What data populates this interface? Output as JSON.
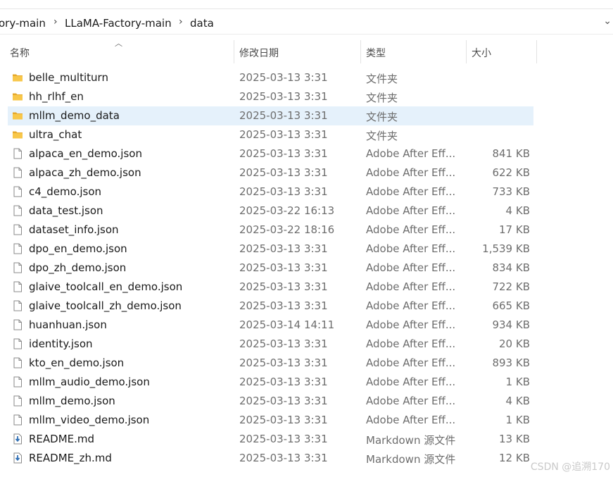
{
  "breadcrumb": {
    "segments": [
      "ory-main",
      "LLaMA-Factory-main",
      "data"
    ],
    "separator": "›"
  },
  "columns": {
    "name": "名称",
    "modified": "修改日期",
    "type": "类型",
    "size": "大小"
  },
  "files": [
    {
      "name": "belle_multiturn",
      "modified": "2025-03-13 3:31",
      "type": "文件夹",
      "size": "",
      "icon": "folder-icon",
      "selected": false
    },
    {
      "name": "hh_rlhf_en",
      "modified": "2025-03-13 3:31",
      "type": "文件夹",
      "size": "",
      "icon": "folder-icon",
      "selected": false
    },
    {
      "name": "mllm_demo_data",
      "modified": "2025-03-13 3:31",
      "type": "文件夹",
      "size": "",
      "icon": "folder-icon",
      "selected": true
    },
    {
      "name": "ultra_chat",
      "modified": "2025-03-13 3:31",
      "type": "文件夹",
      "size": "",
      "icon": "folder-icon",
      "selected": false
    },
    {
      "name": "alpaca_en_demo.json",
      "modified": "2025-03-13 3:31",
      "type": "Adobe After Eff...",
      "size": "841 KB",
      "icon": "file-icon",
      "selected": false
    },
    {
      "name": "alpaca_zh_demo.json",
      "modified": "2025-03-13 3:31",
      "type": "Adobe After Eff...",
      "size": "622 KB",
      "icon": "file-icon",
      "selected": false
    },
    {
      "name": "c4_demo.json",
      "modified": "2025-03-13 3:31",
      "type": "Adobe After Eff...",
      "size": "733 KB",
      "icon": "file-icon",
      "selected": false
    },
    {
      "name": "data_test.json",
      "modified": "2025-03-22 16:13",
      "type": "Adobe After Eff...",
      "size": "4 KB",
      "icon": "file-icon",
      "selected": false
    },
    {
      "name": "dataset_info.json",
      "modified": "2025-03-22 18:16",
      "type": "Adobe After Eff...",
      "size": "17 KB",
      "icon": "file-icon",
      "selected": false
    },
    {
      "name": "dpo_en_demo.json",
      "modified": "2025-03-13 3:31",
      "type": "Adobe After Eff...",
      "size": "1,539 KB",
      "icon": "file-icon",
      "selected": false
    },
    {
      "name": "dpo_zh_demo.json",
      "modified": "2025-03-13 3:31",
      "type": "Adobe After Eff...",
      "size": "834 KB",
      "icon": "file-icon",
      "selected": false
    },
    {
      "name": "glaive_toolcall_en_demo.json",
      "modified": "2025-03-13 3:31",
      "type": "Adobe After Eff...",
      "size": "722 KB",
      "icon": "file-icon",
      "selected": false
    },
    {
      "name": "glaive_toolcall_zh_demo.json",
      "modified": "2025-03-13 3:31",
      "type": "Adobe After Eff...",
      "size": "665 KB",
      "icon": "file-icon",
      "selected": false
    },
    {
      "name": "huanhuan.json",
      "modified": "2025-03-14 14:11",
      "type": "Adobe After Eff...",
      "size": "934 KB",
      "icon": "file-icon",
      "selected": false
    },
    {
      "name": "identity.json",
      "modified": "2025-03-13 3:31",
      "type": "Adobe After Eff...",
      "size": "20 KB",
      "icon": "file-icon",
      "selected": false
    },
    {
      "name": "kto_en_demo.json",
      "modified": "2025-03-13 3:31",
      "type": "Adobe After Eff...",
      "size": "893 KB",
      "icon": "file-icon",
      "selected": false
    },
    {
      "name": "mllm_audio_demo.json",
      "modified": "2025-03-13 3:31",
      "type": "Adobe After Eff...",
      "size": "1 KB",
      "icon": "file-icon",
      "selected": false
    },
    {
      "name": "mllm_demo.json",
      "modified": "2025-03-13 3:31",
      "type": "Adobe After Eff...",
      "size": "4 KB",
      "icon": "file-icon",
      "selected": false
    },
    {
      "name": "mllm_video_demo.json",
      "modified": "2025-03-13 3:31",
      "type": "Adobe After Eff...",
      "size": "1 KB",
      "icon": "file-icon",
      "selected": false
    },
    {
      "name": "README.md",
      "modified": "2025-03-13 3:31",
      "type": "Markdown 源文件",
      "size": "13 KB",
      "icon": "markdown-icon",
      "selected": false
    },
    {
      "name": "README_zh.md",
      "modified": "2025-03-13 3:31",
      "type": "Markdown 源文件",
      "size": "12 KB",
      "icon": "markdown-icon",
      "selected": false
    }
  ],
  "watermark": "CSDN @追溯170",
  "colors": {
    "selection": "#e5f1fb",
    "folder": "#f8c74a",
    "folder_dark": "#e6a92b",
    "markdown": "#2f6fb5"
  }
}
